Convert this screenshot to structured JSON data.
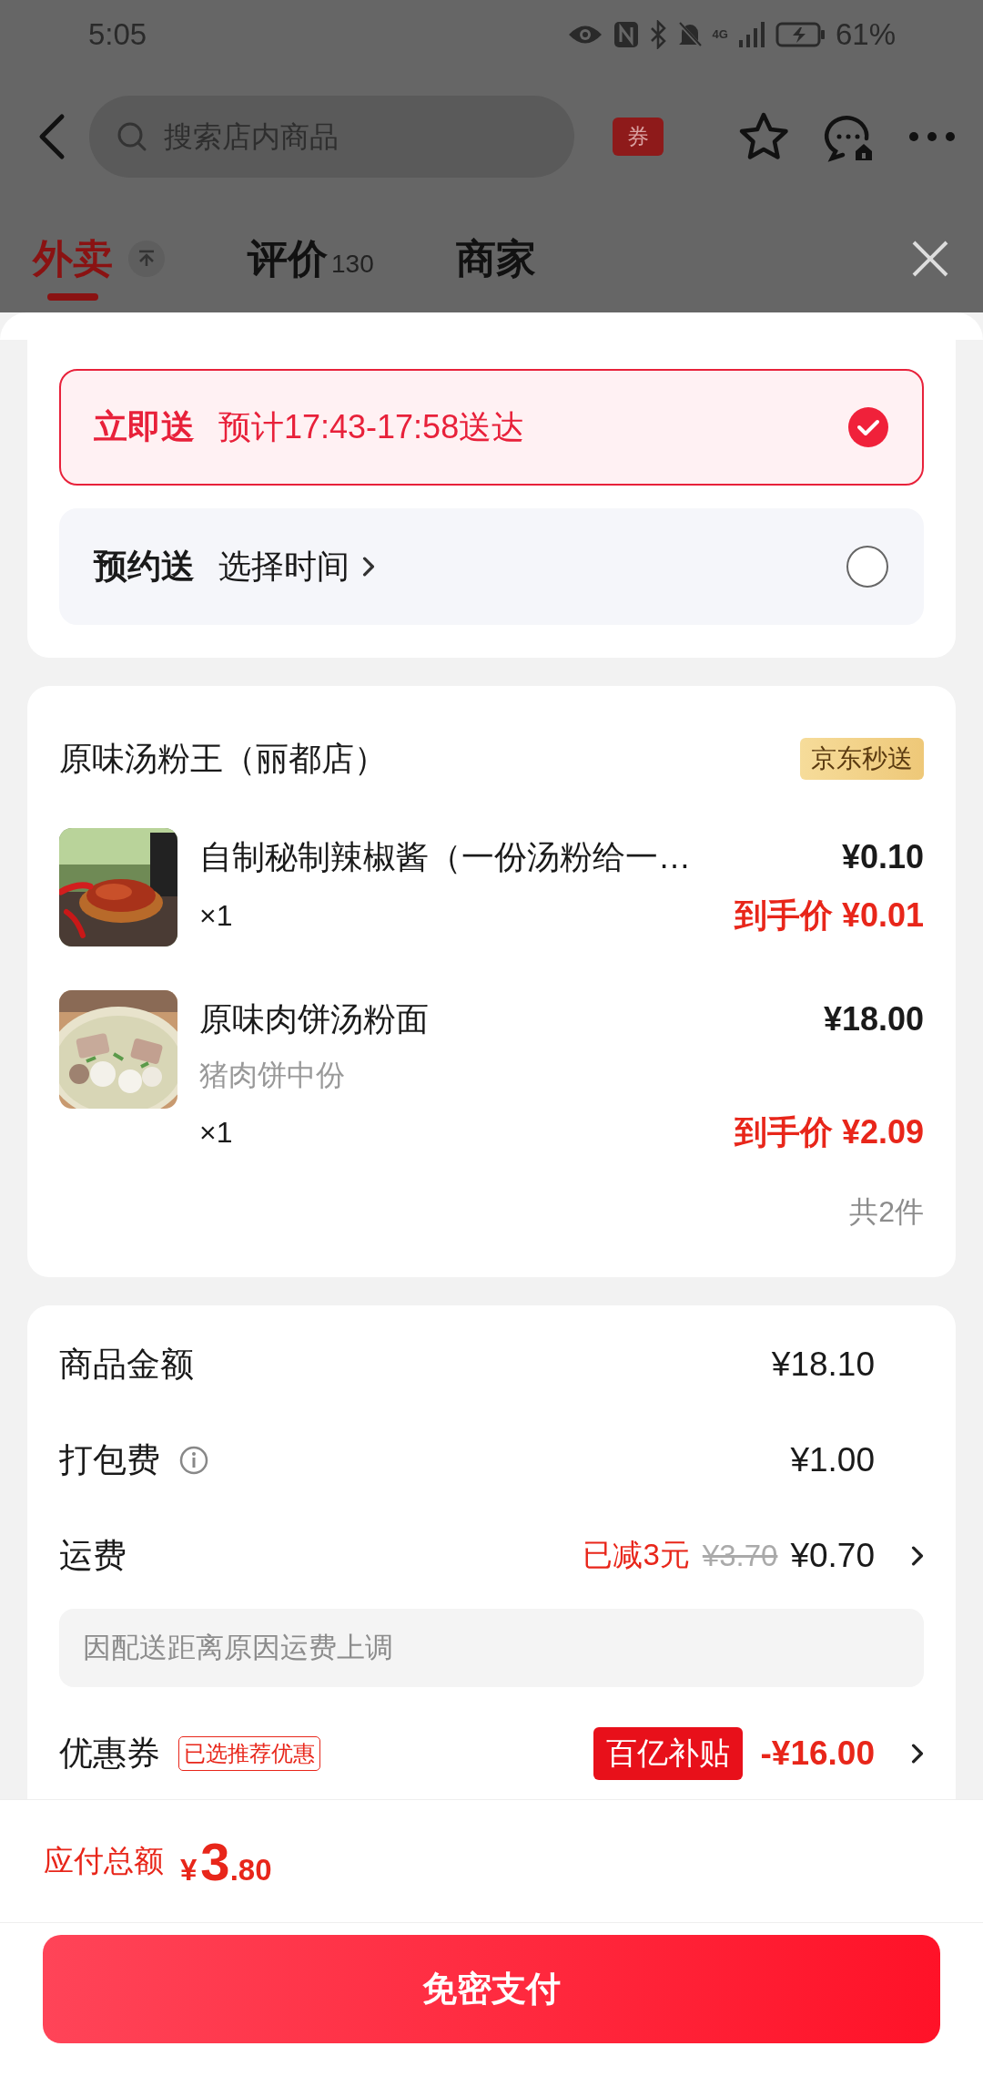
{
  "status_bar": {
    "time": "5:05",
    "network": "4G",
    "battery": "61%"
  },
  "header": {
    "search": {
      "placeholder": "搜索店内商品"
    },
    "coupon_badge": "券"
  },
  "tabs": [
    {
      "label": "外卖",
      "selected": true
    },
    {
      "label": "评价",
      "count": "130",
      "selected": false
    },
    {
      "label": "商家",
      "selected": false
    }
  ],
  "delivery_options": [
    {
      "label": "立即送",
      "detail": "预计17:43-17:58送达",
      "selected": true
    },
    {
      "label": "预约送",
      "detail": "选择时间",
      "selected": false
    }
  ],
  "store": {
    "name": "原味汤粉王（丽都店）",
    "badge": "京东秒送",
    "items": [
      {
        "name": "自制秘制辣椒酱（一份汤粉给一…",
        "quantity": "×1",
        "price": "¥0.10",
        "final_label": "到手价",
        "final_price": "¥0.01"
      },
      {
        "name": "原味肉饼汤粉面",
        "spec": "猪肉饼中份",
        "quantity": "×1",
        "price": "¥18.00",
        "final_label": "到手价",
        "final_price": "¥2.09"
      }
    ],
    "count": "共2件"
  },
  "fees": [
    {
      "kind": "plain",
      "label": "商品金额",
      "value": "¥18.10"
    },
    {
      "kind": "info",
      "label": "打包费",
      "value": "¥1.00"
    },
    {
      "kind": "discount",
      "label": "运费",
      "discount": "已减3元",
      "original": "¥3.70",
      "value": "¥0.70",
      "note": "因配送距离原因运费上调"
    },
    {
      "kind": "coupon",
      "label": "优惠券",
      "tag": "已选推荐优惠",
      "badge": "百亿补贴",
      "value": "-¥16.00"
    }
  ],
  "total": {
    "label": "应付总额",
    "currency": "¥",
    "integer": "3",
    "decimal": ".80"
  },
  "pay_button": "免密支付"
}
